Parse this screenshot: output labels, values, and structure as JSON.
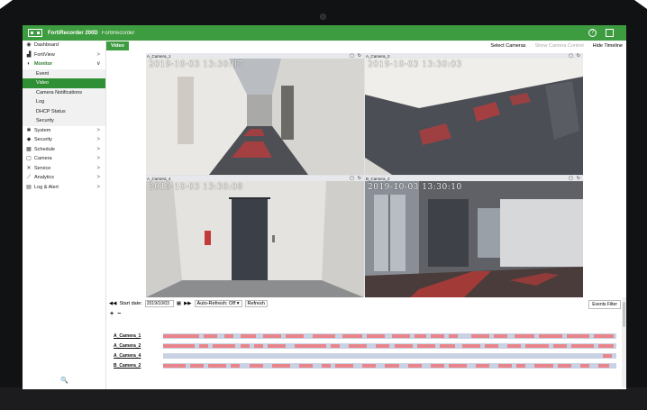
{
  "header": {
    "app_title": "FortiRecorder 200D",
    "subtitle": "FortiRecorder",
    "help_glyph": "?"
  },
  "sidebar": {
    "items": [
      {
        "label": "Dashboard",
        "icon": "dashboard-icon",
        "glyph": "◉",
        "chev": ""
      },
      {
        "label": "FortiView",
        "icon": "chart-icon",
        "glyph": "▟",
        "chev": ">"
      },
      {
        "label": "Monitor",
        "icon": "monitor-icon",
        "glyph": "◐",
        "chev": "v"
      },
      {
        "label": "Event",
        "sub": true
      },
      {
        "label": "Video",
        "sub": true,
        "active": true
      },
      {
        "label": "Camera Notifications",
        "sub": true
      },
      {
        "label": "Log",
        "sub": true
      },
      {
        "label": "DHCP Status",
        "sub": true
      },
      {
        "label": "Security",
        "sub": true
      },
      {
        "label": "System",
        "icon": "gear-icon",
        "glyph": "✱",
        "chev": ">"
      },
      {
        "label": "Security",
        "icon": "shield-icon",
        "glyph": "◆",
        "chev": ">"
      },
      {
        "label": "Schedule",
        "icon": "calendar-icon",
        "glyph": "▦",
        "chev": ">"
      },
      {
        "label": "Camera",
        "icon": "camera-icon",
        "glyph": "▢",
        "chev": ">"
      },
      {
        "label": "Service",
        "icon": "tools-icon",
        "glyph": "✕",
        "chev": ">"
      },
      {
        "label": "Analytics",
        "icon": "analytics-icon",
        "glyph": "⟋",
        "chev": ">"
      },
      {
        "label": "Log & Alert",
        "icon": "log-icon",
        "glyph": "▤",
        "chev": ">"
      }
    ],
    "search_glyph": "🔍"
  },
  "main": {
    "tab": "Video",
    "actions": {
      "select_cameras": "Select Cameras",
      "show_camera_control": "Show Camera Control",
      "hide_timeline": "Hide Timeline"
    },
    "cameras": [
      {
        "name": "A_Camera_1",
        "timestamp": "2019-10-03 13:30:07"
      },
      {
        "name": "A_Camera_2",
        "timestamp": "2019-10-03 13:30:03"
      },
      {
        "name": "A_Camera_4",
        "timestamp": "2019-10-03 13:30:08"
      },
      {
        "name": "B_Camera_2",
        "timestamp": "2019-10-03 13:30:10"
      }
    ],
    "timeline": {
      "start_label": "Start date:",
      "start_date": "2019/10/03",
      "auto_refresh": "Auto-Refresh: Off ▾",
      "refresh": "Refresh",
      "events_filter": "Events Filter",
      "rows": [
        {
          "label": "A_Camera_1",
          "segments": [
            [
              0,
              8
            ],
            [
              9,
              12
            ],
            [
              13.5,
              15.5
            ],
            [
              17,
              20.5
            ],
            [
              22,
              26
            ],
            [
              27,
              31
            ],
            [
              33,
              38
            ],
            [
              39.5,
              44
            ],
            [
              45,
              49
            ],
            [
              50.5,
              54.5
            ],
            [
              55.5,
              58
            ],
            [
              59,
              62
            ],
            [
              63,
              65
            ],
            [
              68,
              72
            ],
            [
              73,
              76
            ],
            [
              77.5,
              82
            ],
            [
              83,
              88
            ],
            [
              89,
              94
            ],
            [
              95,
              99.5
            ]
          ]
        },
        {
          "label": "A_Camera_2",
          "segments": [
            [
              0,
              7
            ],
            [
              8,
              10
            ],
            [
              11,
              16
            ],
            [
              17,
              19
            ],
            [
              20,
              22
            ],
            [
              23,
              27
            ],
            [
              29,
              36
            ],
            [
              37,
              39
            ],
            [
              41,
              45
            ],
            [
              47,
              50
            ],
            [
              51,
              55
            ],
            [
              56,
              60
            ],
            [
              61,
              64.5
            ],
            [
              66,
              70
            ],
            [
              71,
              74
            ],
            [
              76,
              79
            ],
            [
              80,
              85
            ],
            [
              86,
              89
            ],
            [
              90,
              95
            ],
            [
              96,
              99.5
            ]
          ]
        },
        {
          "label": "A_Camera_4",
          "segments": [
            [
              97,
              99
            ]
          ]
        },
        {
          "label": "B_Camera_2",
          "segments": [
            [
              0,
              5
            ],
            [
              6,
              9
            ],
            [
              10,
              14
            ],
            [
              15,
              17
            ],
            [
              19,
              22
            ],
            [
              24,
              28
            ],
            [
              30,
              33
            ],
            [
              35,
              37
            ],
            [
              38,
              42
            ],
            [
              44,
              47
            ],
            [
              49,
              52
            ],
            [
              54,
              57
            ],
            [
              59,
              62
            ],
            [
              63,
              67
            ],
            [
              69,
              72
            ],
            [
              74,
              77
            ],
            [
              78,
              80
            ],
            [
              82,
              86
            ],
            [
              87,
              90
            ],
            [
              92,
              94
            ],
            [
              96,
              98.5
            ]
          ]
        }
      ]
    }
  },
  "colors": {
    "brand_green": "#3d9c3f",
    "track": "#c9d2e4",
    "event": "#e9858a"
  }
}
